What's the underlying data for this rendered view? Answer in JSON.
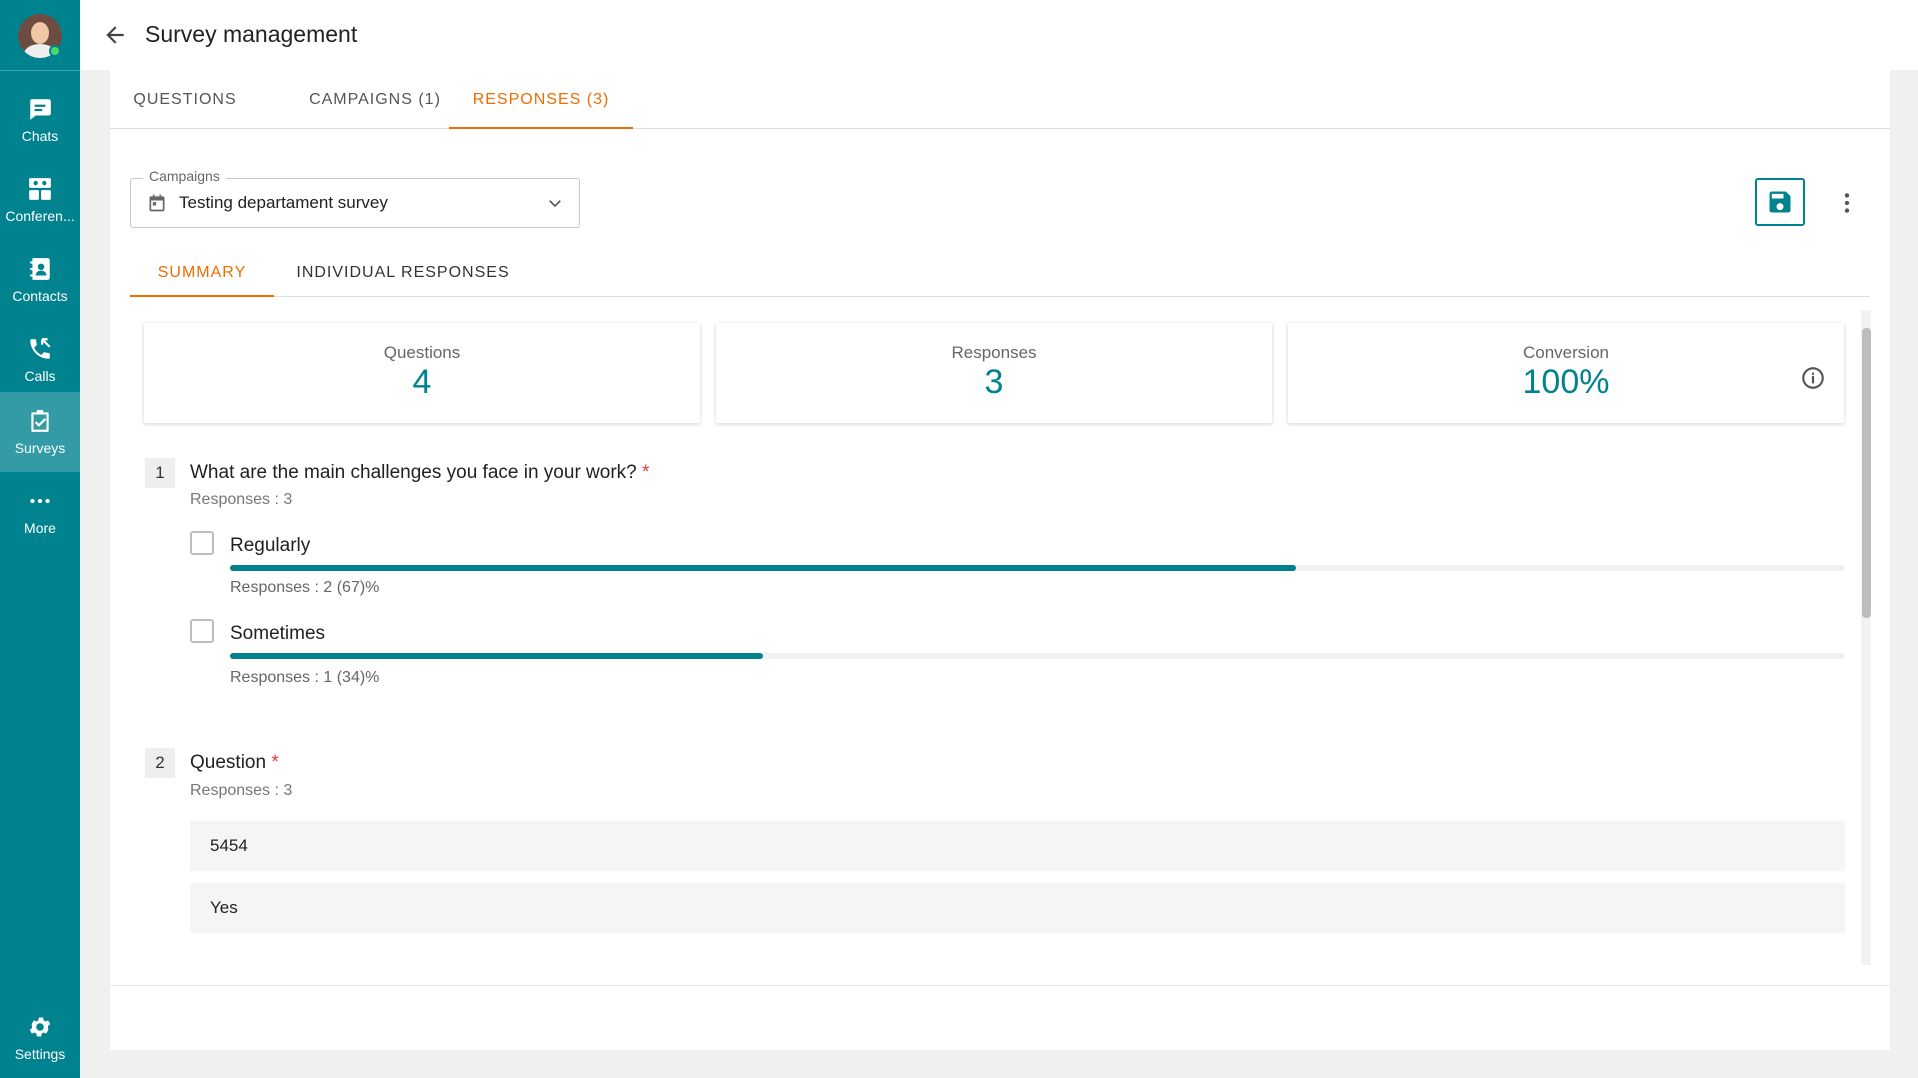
{
  "sidebar": {
    "items": [
      {
        "id": "chats",
        "label": "Chats",
        "icon": "chat-icon"
      },
      {
        "id": "conferences",
        "label": "Conferen...",
        "icon": "conference-icon"
      },
      {
        "id": "contacts",
        "label": "Contacts",
        "icon": "contacts-icon"
      },
      {
        "id": "calls",
        "label": "Calls",
        "icon": "phone-icon"
      },
      {
        "id": "surveys",
        "label": "Surveys",
        "icon": "clipboard-check-icon",
        "active": true
      },
      {
        "id": "more",
        "label": "More",
        "icon": "more-horizontal-icon"
      }
    ],
    "settings": {
      "label": "Settings",
      "icon": "gear-icon"
    }
  },
  "header": {
    "title": "Survey management"
  },
  "tabs": {
    "questions": "QUESTIONS",
    "campaigns": "CAMPAIGNS (1)",
    "responses": "RESPONSES (3)",
    "active": "responses"
  },
  "campaign_select": {
    "label": "Campaigns",
    "value": "Testing departament survey"
  },
  "sub_tabs": {
    "summary": "SUMMARY",
    "individual": "INDIVIDUAL RESPONSES",
    "active": "summary"
  },
  "stats": {
    "questions": {
      "label": "Questions",
      "value": "4"
    },
    "responses": {
      "label": "Responses",
      "value": "3"
    },
    "conversion": {
      "label": "Conversion",
      "value": "100%"
    }
  },
  "questions": [
    {
      "number": "1",
      "title": "What are the main challenges you face in your work?",
      "required_mark": "*",
      "responses": "Responses : 3",
      "options": [
        {
          "label": "Regularly",
          "stats": "Responses : 2 (67)%",
          "fraction": 0.66
        },
        {
          "label": "Sometimes",
          "stats": "Responses : 1 (34)%",
          "fraction": 0.33
        }
      ]
    },
    {
      "number": "2",
      "title": "Question",
      "required_mark": "*",
      "responses": "Responses : 3",
      "answers": [
        "5454",
        "Yes"
      ]
    }
  ],
  "colors": {
    "primary": "#00838f",
    "accent": "#ef6c00",
    "required": "#e53935"
  }
}
